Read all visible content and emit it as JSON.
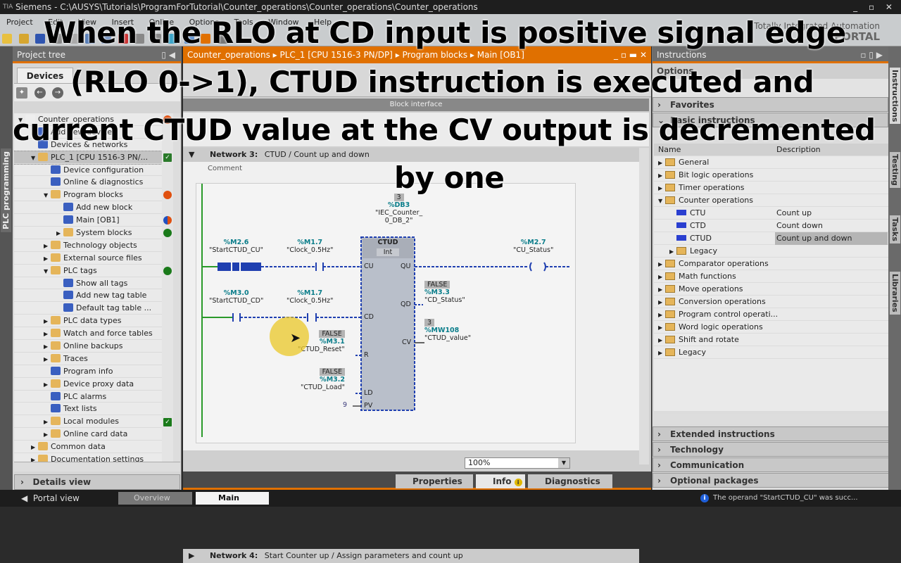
{
  "window": {
    "app_icon": "TIA",
    "title": "Siemens  -  C:\\AUSYS\\Tutorials\\ProgramForTutorial\\Counter_operations\\Counter_operations\\Counter_operations",
    "controls": "_ ▫ ✕"
  },
  "menu": [
    "Project",
    "Edit",
    "View",
    "Insert",
    "Online",
    "Options",
    "Tools",
    "Window",
    "Help"
  ],
  "brand": {
    "line1": "Totally Integrated Automation",
    "line2": "PORTAL"
  },
  "left_vertical_tab": "PLC programming",
  "project_tree": {
    "title": "Project tree",
    "tab": "Devices",
    "items": [
      {
        "label": "Counter_operations",
        "level": 0,
        "expanded": true,
        "status": "warning"
      },
      {
        "label": "Add new device",
        "level": 1
      },
      {
        "label": "Devices & networks",
        "level": 1
      },
      {
        "label": "PLC_1 [CPU 1516-3 PN/...",
        "level": 1,
        "expanded": true,
        "selected": true,
        "status": "ok-check"
      },
      {
        "label": "Device configuration",
        "level": 2
      },
      {
        "label": "Online & diagnostics",
        "level": 2
      },
      {
        "label": "Program blocks",
        "level": 2,
        "expanded": true,
        "status": "warning"
      },
      {
        "label": "Add new block",
        "level": 3
      },
      {
        "label": "Main [OB1]",
        "level": 3,
        "status": "half"
      },
      {
        "label": "System blocks",
        "level": 3,
        "collapsed": true,
        "status": "green"
      },
      {
        "label": "Technology objects",
        "level": 2,
        "collapsed": true
      },
      {
        "label": "External source files",
        "level": 2,
        "collapsed": true
      },
      {
        "label": "PLC tags",
        "level": 2,
        "expanded": true,
        "status": "green"
      },
      {
        "label": "Show all tags",
        "level": 3
      },
      {
        "label": "Add new tag table",
        "level": 3
      },
      {
        "label": "Default tag table ...",
        "level": 3
      },
      {
        "label": "PLC data types",
        "level": 2,
        "collapsed": true
      },
      {
        "label": "Watch and force tables",
        "level": 2,
        "collapsed": true
      },
      {
        "label": "Online backups",
        "level": 2,
        "collapsed": true
      },
      {
        "label": "Traces",
        "level": 2,
        "collapsed": true
      },
      {
        "label": "Program info",
        "level": 2
      },
      {
        "label": "Device proxy data",
        "level": 2,
        "collapsed": true
      },
      {
        "label": "PLC alarms",
        "level": 2
      },
      {
        "label": "Text lists",
        "level": 2
      },
      {
        "label": "Local modules",
        "level": 2,
        "collapsed": true,
        "status": "check"
      },
      {
        "label": "Online card data",
        "level": 2,
        "collapsed": true
      },
      {
        "label": "Common data",
        "level": 1,
        "collapsed": true
      },
      {
        "label": "Documentation settings",
        "level": 1,
        "collapsed": true
      }
    ],
    "details_view": "Details view"
  },
  "editor": {
    "breadcrumb": [
      "Counter_operations",
      "PLC_1 [CPU 1516-3 PN/DP]",
      "Program blocks",
      "Main [OB1]"
    ],
    "block_interface": "Block interface",
    "network3": {
      "label": "Network 3:",
      "title": "CTUD / Count up and down",
      "comment": "Comment"
    },
    "network4": {
      "label": "Network 4:",
      "title": "Start Counter up / Assign parameters and count up"
    },
    "zoom": "100%",
    "ladder": {
      "instance": {
        "value": "3",
        "address": "%DB3",
        "name1": "\"IEC_Counter_",
        "name2": "0_DB_2\""
      },
      "block": {
        "type": "CTUD",
        "datatype": "Int",
        "pins_in": [
          "CU",
          "CD",
          "R",
          "LD",
          "PV"
        ],
        "pins_out": [
          "QU",
          "QD",
          "CV"
        ]
      },
      "cu_contact": {
        "address": "%M2.6",
        "name": "\"StartCTUD_CU\""
      },
      "cu_clock": {
        "address": "%M1.7",
        "name": "\"Clock_0.5Hz\""
      },
      "cd_contact": {
        "address": "%M3.0",
        "name": "\"StartCTUD_CD\""
      },
      "cd_clock": {
        "address": "%M1.7",
        "name": "\"Clock_0.5Hz\""
      },
      "reset": {
        "value": "FALSE",
        "address": "%M3.1",
        "name": "\"CTUD_Reset\""
      },
      "load": {
        "value": "FALSE",
        "address": "%M3.2",
        "name": "\"CTUD_Load\""
      },
      "pv": "9",
      "qu_coil": {
        "address": "%M2.7",
        "name": "\"CU_Status\""
      },
      "qd": {
        "value": "FALSE",
        "address": "%M3.3",
        "name": "\"CD_Status\""
      },
      "cv": {
        "value": "3",
        "address": "%MW108",
        "name": "\"CTUD_value\""
      }
    }
  },
  "inspector_tabs": [
    "Properties",
    "Info",
    "Diagnostics"
  ],
  "instructions": {
    "title": "Instructions",
    "options": "Options",
    "sections_top": [
      "Favorites",
      "Basic instructions"
    ],
    "columns": [
      "Name",
      "Description"
    ],
    "items": [
      {
        "label": "General",
        "level": 0
      },
      {
        "label": "Bit logic operations",
        "level": 0
      },
      {
        "label": "Timer operations",
        "level": 0
      },
      {
        "label": "Counter operations",
        "level": 0,
        "expanded": true
      },
      {
        "label": "CTU",
        "desc": "Count up",
        "level": 1,
        "block": true
      },
      {
        "label": "CTD",
        "desc": "Count down",
        "level": 1,
        "block": true
      },
      {
        "label": "CTUD",
        "desc": "Count up and down",
        "level": 1,
        "block": true,
        "selected": true
      },
      {
        "label": "Legacy",
        "level": 1
      },
      {
        "label": "Comparator operations",
        "level": 0
      },
      {
        "label": "Math functions",
        "level": 0
      },
      {
        "label": "Move operations",
        "level": 0
      },
      {
        "label": "Conversion operations",
        "level": 0
      },
      {
        "label": "Program control operati...",
        "level": 0
      },
      {
        "label": "Word logic operations",
        "level": 0
      },
      {
        "label": "Shift and rotate",
        "level": 0
      },
      {
        "label": "Legacy",
        "level": 0
      }
    ],
    "sections_bottom": [
      "Extended instructions",
      "Technology",
      "Communication",
      "Optional packages"
    ]
  },
  "right_vertical_tabs": [
    "Instructions",
    "Testing",
    "Tasks",
    "Libraries"
  ],
  "statusbar": {
    "portal_view": "Portal view",
    "overview": "Overview",
    "main": "Main",
    "message": "The operand \"StartCTUD_CU\" was succ..."
  },
  "caption": {
    "line1": "When the RLO at CD input is positive signal edge",
    "line2": "(RLO 0->1), CTUD instruction is executed and",
    "line3": "current CTUD value at the CV output is decremented",
    "line4": "by one"
  }
}
